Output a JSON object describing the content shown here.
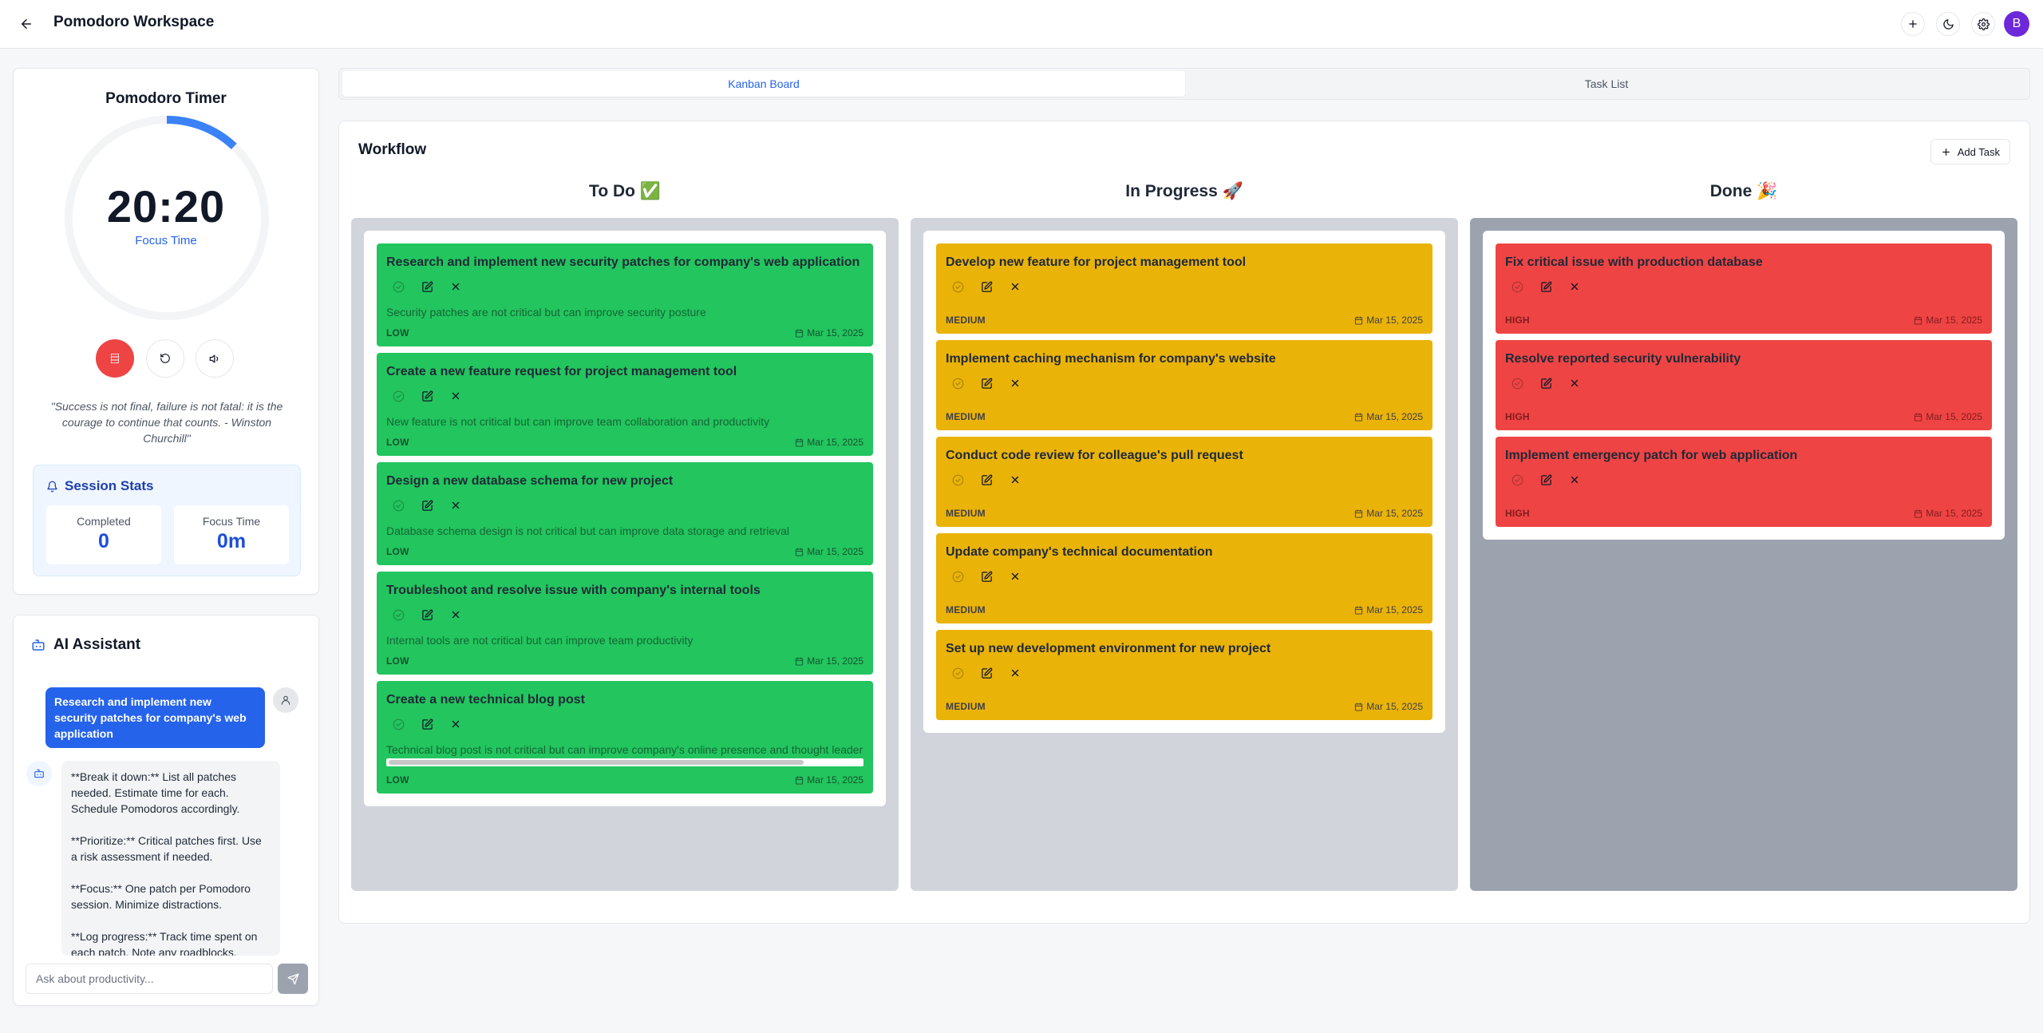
{
  "header": {
    "title": "Pomodoro Workspace",
    "avatar_initial": "B"
  },
  "timer": {
    "title": "Pomodoro Timer",
    "time": "20:20",
    "mode": "Focus Time",
    "progress_fraction": 0.12,
    "accent": "#3b82f6",
    "quote": "\"Success is not final, failure is not fatal: it is the courage to continue that counts. - Winston Churchill\""
  },
  "stats": {
    "title": "Session Stats",
    "completed_label": "Completed",
    "completed_value": "0",
    "focus_label": "Focus Time",
    "focus_value": "0m"
  },
  "assistant": {
    "title": "AI Assistant",
    "user_message": "Research and implement new security patches for company's web application",
    "bot_message": "**Break it down:**  List all patches needed.  Estimate time for each.  Schedule Pomodoros accordingly.\n\n**Prioritize:**  Critical patches first.  Use a risk assessment if needed.\n\n**Focus:** One patch per Pomodoro session.  Minimize distractions.\n\n**Log progress:** Track time spent on each patch.  Note any roadblocks.",
    "input_placeholder": "Ask about productivity..."
  },
  "tabs": [
    {
      "label": "Kanban Board",
      "active": true
    },
    {
      "label": "Task List",
      "active": false
    }
  ],
  "board": {
    "title": "Workflow",
    "add_task_label": "Add Task",
    "columns": [
      {
        "title": "To Do ✅",
        "bg": "#d1d5db",
        "color": "green",
        "tasks": [
          {
            "title": "Research and implement new security patches for company's web application",
            "description": "Security patches are not critical but can improve security posture",
            "priority": "LOW",
            "due": "Mar 15, 2025"
          },
          {
            "title": "Create a new feature request for project management tool",
            "description": "New feature is not critical but can improve team collaboration and productivity",
            "priority": "LOW",
            "due": "Mar 15, 2025"
          },
          {
            "title": "Design a new database schema for new project",
            "description": "Database schema design is not critical but can improve data storage and retrieval",
            "priority": "LOW",
            "due": "Mar 15, 2025"
          },
          {
            "title": "Troubleshoot and resolve issue with company's internal tools",
            "description": "Internal tools are not critical but can improve team productivity",
            "priority": "LOW",
            "due": "Mar 15, 2025"
          },
          {
            "title": "Create a new technical blog post",
            "description": "Technical blog post is not critical but can improve company's online presence and thought leadership",
            "priority": "LOW",
            "due": "Mar 15, 2025",
            "scroll": true
          }
        ]
      },
      {
        "title": "In Progress 🚀",
        "bg": "#d1d5db",
        "color": "yellow",
        "tasks": [
          {
            "title": "Develop new feature for project management tool",
            "priority": "MEDIUM",
            "due": "Mar 15, 2025"
          },
          {
            "title": "Implement caching mechanism for company's website",
            "priority": "MEDIUM",
            "due": "Mar 15, 2025"
          },
          {
            "title": "Conduct code review for colleague's pull request",
            "priority": "MEDIUM",
            "due": "Mar 15, 2025"
          },
          {
            "title": "Update company's technical documentation",
            "priority": "MEDIUM",
            "due": "Mar 15, 2025"
          },
          {
            "title": "Set up new development environment for new project",
            "priority": "MEDIUM",
            "due": "Mar 15, 2025"
          }
        ]
      },
      {
        "title": "Done 🎉",
        "bg": "#9ca3af",
        "color": "red",
        "tasks": [
          {
            "title": "Fix critical issue with production database",
            "priority": "HIGH",
            "due": "Mar 15, 2025"
          },
          {
            "title": "Resolve reported security vulnerability",
            "priority": "HIGH",
            "due": "Mar 15, 2025"
          },
          {
            "title": "Implement emergency patch for web application",
            "priority": "HIGH",
            "due": "Mar 15, 2025"
          }
        ]
      }
    ]
  }
}
